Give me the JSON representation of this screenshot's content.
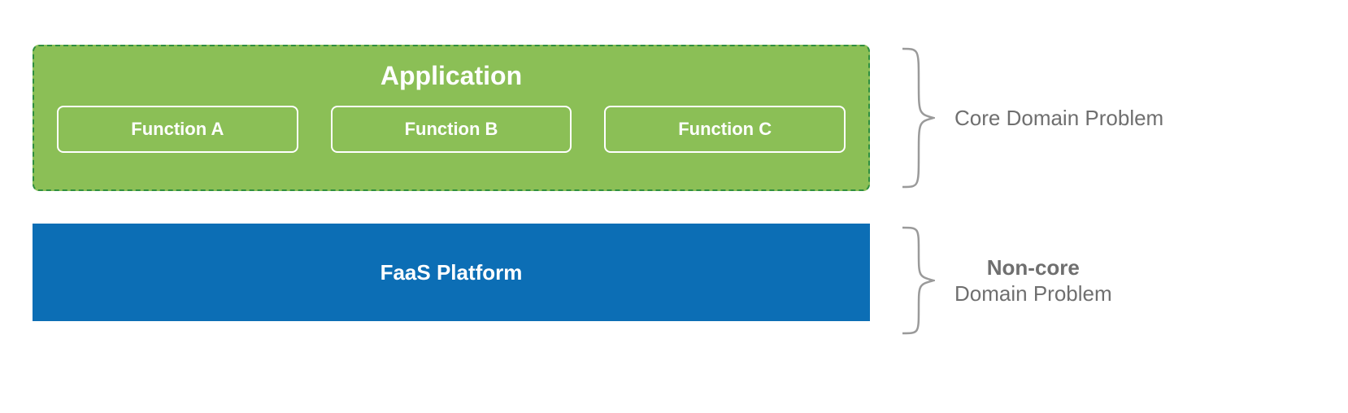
{
  "application": {
    "title": "Application",
    "functions": [
      "Function A",
      "Function B",
      "Function C"
    ]
  },
  "platform": {
    "title": "FaaS Platform"
  },
  "annotations": {
    "core": "Core Domain Problem",
    "noncore_bold": "Non-core",
    "noncore_rest": "Domain Problem"
  },
  "colors": {
    "app_bg": "#8bbf56",
    "app_border": "#2f8f3f",
    "faas_bg": "#0c6eb5",
    "label": "#6f6f6f"
  }
}
